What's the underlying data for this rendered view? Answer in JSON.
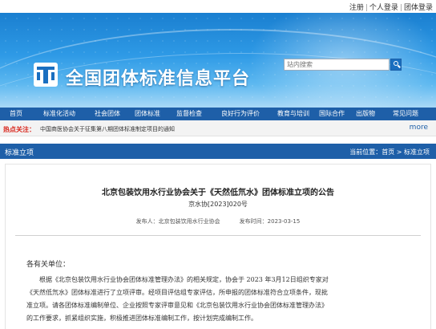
{
  "top_links": {
    "login": "注册",
    "personal_login": "个人登录",
    "group_login": "团体登录",
    "separator": "|"
  },
  "header": {
    "site_title": "全国团体标准信息平台",
    "search_placeholder": "站内搜索"
  },
  "nav": {
    "items": [
      "首页",
      "标准化活动",
      "社会团体",
      "团体标准",
      "监督检查",
      "良好行为评价",
      "教育与培训",
      "国际合作",
      "出版物",
      "常见问题"
    ]
  },
  "hot": {
    "label": "热点关注：",
    "text": "中国商医协会关于征集第八期团体标准制定项目的通知",
    "more": "more"
  },
  "section": {
    "title": "标准立项",
    "breadcrumb_prefix": "当前位置：",
    "breadcrumb_home": "首页",
    "breadcrumb_sep": " > ",
    "breadcrumb_current": "标准立项"
  },
  "article": {
    "title": "北京包装饮用水行业协会关于《天然低氘水》团体标准立项的公告",
    "doc_no": "京水协[2023]020号",
    "publisher_label": "发布人：",
    "publisher": "北京包装饮用水行业协会",
    "date_label": "发布时间：",
    "date": "2023-03-15",
    "salutation": "各有关单位：",
    "lines": [
      "根据《北京包装饮用水行业协会团体标准管理办法》的相关规定，协会于 2023 年3月12日组织专家对",
      "《天然低氘水》团体标准进行了立项评审。经项目评估组专家评估，所申报的团体标准符合立项条件，现批",
      "准立项。请各团体标准编制单位、企业按照专家评审意见和《北京包装饮用水行业协会团体标准管理办法》",
      "的工作要求，抓紧组织实施，积极推进团体标准编制工作，按计划完成编制工作。"
    ]
  },
  "colors": {
    "nav_blue": "#1e5fa8",
    "hot_red": "#d9261c",
    "banner_blue": "#2e9ae6"
  },
  "icons": {
    "logo": "t-logo-icon",
    "search": "search-icon"
  }
}
